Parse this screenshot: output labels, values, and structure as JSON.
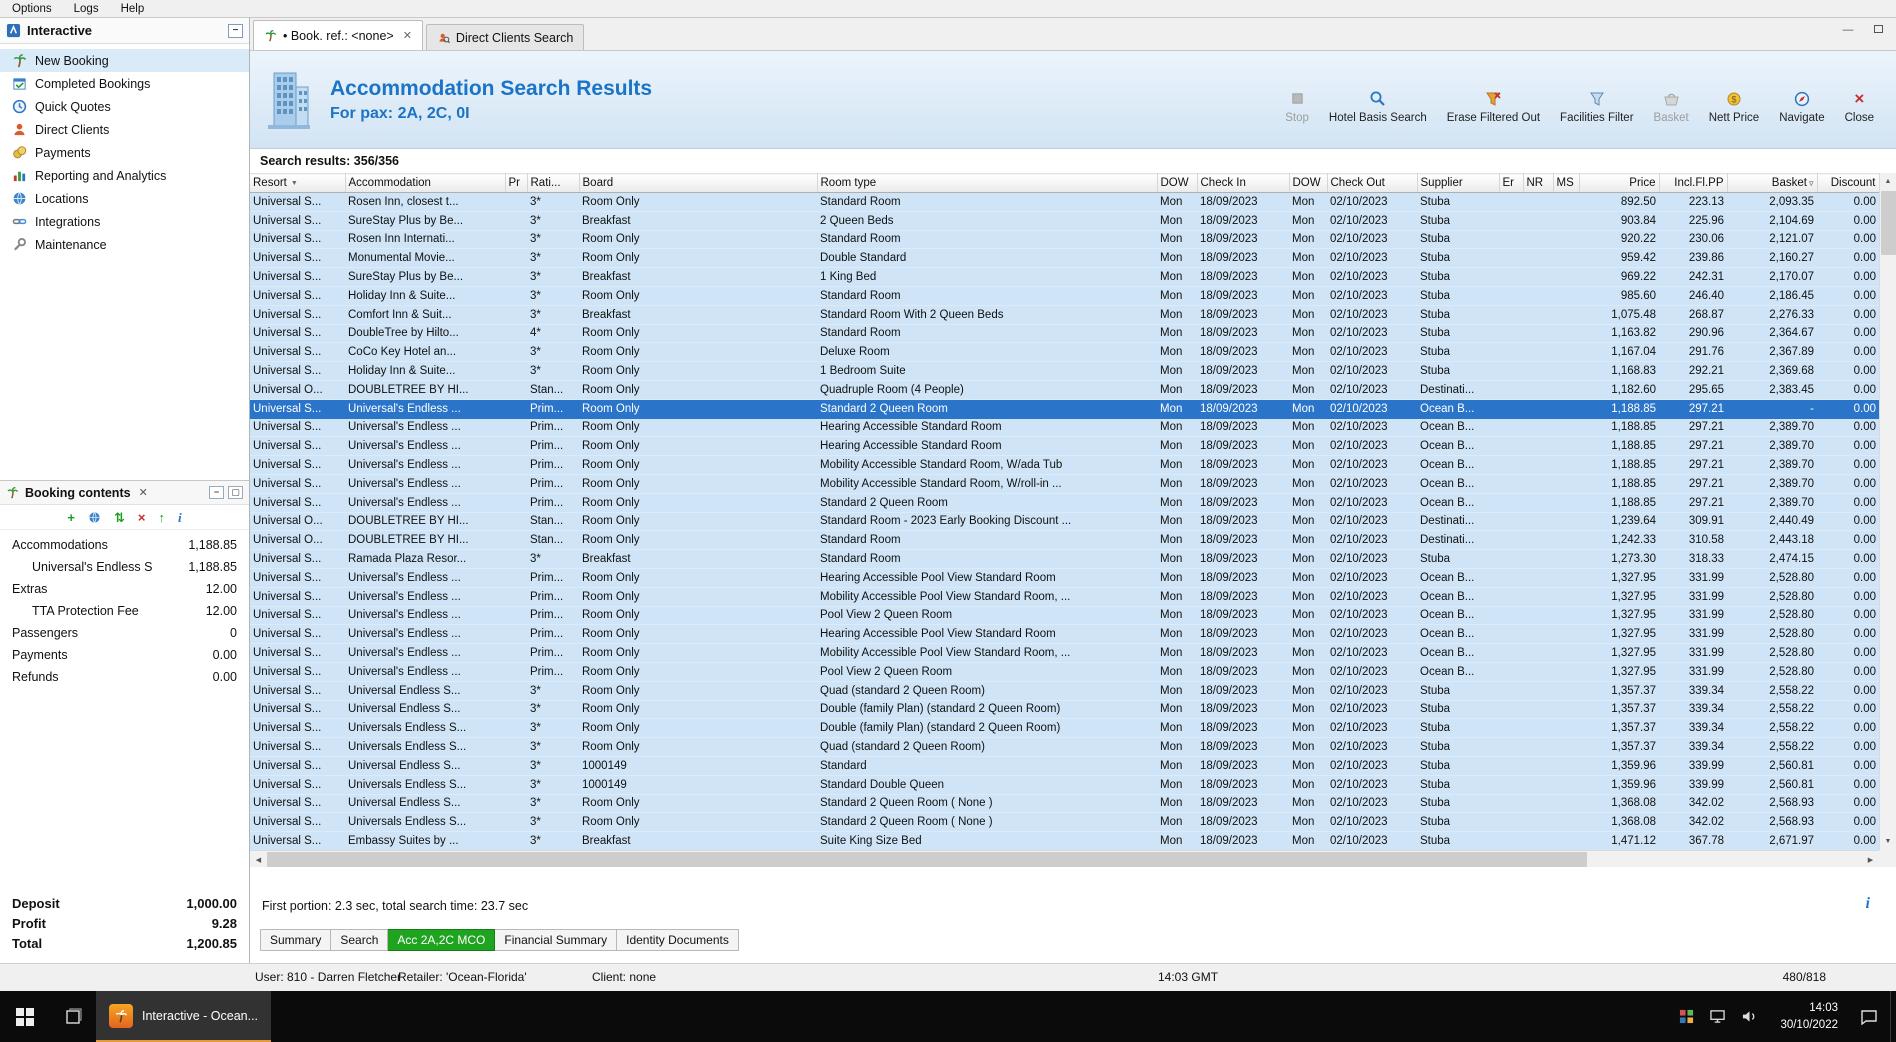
{
  "menu": {
    "items": [
      "Options",
      "Logs",
      "Help"
    ]
  },
  "sidebar": {
    "title": "Interactive",
    "items": [
      {
        "label": "New Booking"
      },
      {
        "label": "Completed Bookings"
      },
      {
        "label": "Quick Quotes"
      },
      {
        "label": "Direct Clients"
      },
      {
        "label": "Payments"
      },
      {
        "label": "Reporting and Analytics"
      },
      {
        "label": "Locations"
      },
      {
        "label": "Integrations"
      },
      {
        "label": "Maintenance"
      }
    ]
  },
  "booking_contents": {
    "title": "Booking contents",
    "tree": [
      {
        "label": "Accommodations",
        "value": "1,188.85",
        "indent": 0
      },
      {
        "label": "Universal's Endless S",
        "value": "1,188.85",
        "indent": 1
      },
      {
        "label": "Extras",
        "value": "12.00",
        "indent": 0
      },
      {
        "label": "TTA Protection Fee",
        "value": "12.00",
        "indent": 1
      },
      {
        "label": "Passengers",
        "value": "0",
        "indent": 0
      },
      {
        "label": "Payments",
        "value": "0.00",
        "indent": 0
      },
      {
        "label": "Refunds",
        "value": "0.00",
        "indent": 0
      }
    ],
    "totals": [
      {
        "label": "Deposit",
        "value": "1,000.00"
      },
      {
        "label": "Profit",
        "value": "9.28"
      },
      {
        "label": "Total",
        "value": "1,200.85"
      }
    ]
  },
  "tabs": [
    {
      "label": "• Book. ref.: <none>",
      "active": true
    },
    {
      "label": "Direct Clients Search",
      "active": false
    }
  ],
  "header": {
    "title": "Accommodation Search Results",
    "subtitle": "For pax: 2A, 2C, 0I",
    "toolbar": [
      {
        "label": "Stop",
        "disabled": true
      },
      {
        "label": "Hotel Basis Search",
        "disabled": false
      },
      {
        "label": "Erase Filtered Out",
        "disabled": false
      },
      {
        "label": "Facilities Filter",
        "disabled": false
      },
      {
        "label": "Basket",
        "disabled": true
      },
      {
        "label": "Nett Price",
        "disabled": false
      },
      {
        "label": "Navigate",
        "disabled": false
      },
      {
        "label": "Close",
        "disabled": false
      }
    ]
  },
  "results": {
    "label": "Search results: 356/356"
  },
  "table": {
    "columns": [
      "Resort",
      "Accommodation",
      "Pr",
      "Rati...",
      "Board",
      "Room type",
      "DOW",
      "Check In",
      "DOW",
      "Check Out",
      "Supplier",
      "Er",
      "NR",
      "MS",
      "Price",
      "Incl.Fl.PP",
      "Basket",
      "Discount"
    ],
    "selected_index": 11,
    "rows": [
      [
        "Universal S...",
        "Rosen Inn, closest t...",
        "",
        "3*",
        "Room Only",
        "Standard Room",
        "Mon",
        "18/09/2023",
        "Mon",
        "02/10/2023",
        "Stuba",
        "",
        "",
        "",
        "892.50",
        "223.13",
        "2,093.35",
        "0.00"
      ],
      [
        "Universal S...",
        "SureStay Plus by Be...",
        "",
        "3*",
        "Breakfast",
        "2 Queen Beds",
        "Mon",
        "18/09/2023",
        "Mon",
        "02/10/2023",
        "Stuba",
        "",
        "",
        "",
        "903.84",
        "225.96",
        "2,104.69",
        "0.00"
      ],
      [
        "Universal S...",
        "Rosen Inn Internati...",
        "",
        "3*",
        "Room Only",
        "Standard Room",
        "Mon",
        "18/09/2023",
        "Mon",
        "02/10/2023",
        "Stuba",
        "",
        "",
        "",
        "920.22",
        "230.06",
        "2,121.07",
        "0.00"
      ],
      [
        "Universal S...",
        "Monumental Movie...",
        "",
        "3*",
        "Room Only",
        "Double Standard",
        "Mon",
        "18/09/2023",
        "Mon",
        "02/10/2023",
        "Stuba",
        "",
        "",
        "",
        "959.42",
        "239.86",
        "2,160.27",
        "0.00"
      ],
      [
        "Universal S...",
        "SureStay Plus by Be...",
        "",
        "3*",
        "Breakfast",
        "1 King Bed",
        "Mon",
        "18/09/2023",
        "Mon",
        "02/10/2023",
        "Stuba",
        "",
        "",
        "",
        "969.22",
        "242.31",
        "2,170.07",
        "0.00"
      ],
      [
        "Universal S...",
        "Holiday Inn & Suite...",
        "",
        "3*",
        "Room Only",
        "Standard Room",
        "Mon",
        "18/09/2023",
        "Mon",
        "02/10/2023",
        "Stuba",
        "",
        "",
        "",
        "985.60",
        "246.40",
        "2,186.45",
        "0.00"
      ],
      [
        "Universal S...",
        "Comfort Inn & Suit...",
        "",
        "3*",
        "Breakfast",
        "Standard Room With 2 Queen Beds",
        "Mon",
        "18/09/2023",
        "Mon",
        "02/10/2023",
        "Stuba",
        "",
        "",
        "",
        "1,075.48",
        "268.87",
        "2,276.33",
        "0.00"
      ],
      [
        "Universal S...",
        "DoubleTree by Hilto...",
        "",
        "4*",
        "Room Only",
        "Standard Room",
        "Mon",
        "18/09/2023",
        "Mon",
        "02/10/2023",
        "Stuba",
        "",
        "",
        "",
        "1,163.82",
        "290.96",
        "2,364.67",
        "0.00"
      ],
      [
        "Universal S...",
        "CoCo Key Hotel an...",
        "",
        "3*",
        "Room Only",
        "Deluxe Room",
        "Mon",
        "18/09/2023",
        "Mon",
        "02/10/2023",
        "Stuba",
        "",
        "",
        "",
        "1,167.04",
        "291.76",
        "2,367.89",
        "0.00"
      ],
      [
        "Universal S...",
        "Holiday Inn & Suite...",
        "",
        "3*",
        "Room Only",
        "1 Bedroom Suite",
        "Mon",
        "18/09/2023",
        "Mon",
        "02/10/2023",
        "Stuba",
        "",
        "",
        "",
        "1,168.83",
        "292.21",
        "2,369.68",
        "0.00"
      ],
      [
        "Universal O...",
        "DOUBLETREE BY HI...",
        "",
        "Stan...",
        "Room Only",
        "Quadruple Room (4 People)",
        "Mon",
        "18/09/2023",
        "Mon",
        "02/10/2023",
        "Destinati...",
        "",
        "",
        "",
        "1,182.60",
        "295.65",
        "2,383.45",
        "0.00"
      ],
      [
        "Universal S...",
        "Universal's Endless ...",
        "",
        "Prim...",
        "Room Only",
        "Standard 2 Queen Room",
        "Mon",
        "18/09/2023",
        "Mon",
        "02/10/2023",
        "Ocean B...",
        "",
        "",
        "",
        "1,188.85",
        "297.21",
        "-",
        "0.00"
      ],
      [
        "Universal S...",
        "Universal's Endless ...",
        "",
        "Prim...",
        "Room Only",
        "Hearing Accessible Standard Room",
        "Mon",
        "18/09/2023",
        "Mon",
        "02/10/2023",
        "Ocean B...",
        "",
        "",
        "",
        "1,188.85",
        "297.21",
        "2,389.70",
        "0.00"
      ],
      [
        "Universal S...",
        "Universal's Endless ...",
        "",
        "Prim...",
        "Room Only",
        "Hearing Accessible Standard Room",
        "Mon",
        "18/09/2023",
        "Mon",
        "02/10/2023",
        "Ocean B...",
        "",
        "",
        "",
        "1,188.85",
        "297.21",
        "2,389.70",
        "0.00"
      ],
      [
        "Universal S...",
        "Universal's Endless ...",
        "",
        "Prim...",
        "Room Only",
        "Mobility Accessible Standard Room, W/ada Tub",
        "Mon",
        "18/09/2023",
        "Mon",
        "02/10/2023",
        "Ocean B...",
        "",
        "",
        "",
        "1,188.85",
        "297.21",
        "2,389.70",
        "0.00"
      ],
      [
        "Universal S...",
        "Universal's Endless ...",
        "",
        "Prim...",
        "Room Only",
        "Mobility Accessible Standard Room, W/roll-in ...",
        "Mon",
        "18/09/2023",
        "Mon",
        "02/10/2023",
        "Ocean B...",
        "",
        "",
        "",
        "1,188.85",
        "297.21",
        "2,389.70",
        "0.00"
      ],
      [
        "Universal S...",
        "Universal's Endless ...",
        "",
        "Prim...",
        "Room Only",
        "Standard 2 Queen Room",
        "Mon",
        "18/09/2023",
        "Mon",
        "02/10/2023",
        "Ocean B...",
        "",
        "",
        "",
        "1,188.85",
        "297.21",
        "2,389.70",
        "0.00"
      ],
      [
        "Universal O...",
        "DOUBLETREE BY HI...",
        "",
        "Stan...",
        "Room Only",
        "Standard Room - 2023 Early Booking Discount ...",
        "Mon",
        "18/09/2023",
        "Mon",
        "02/10/2023",
        "Destinati...",
        "",
        "",
        "",
        "1,239.64",
        "309.91",
        "2,440.49",
        "0.00"
      ],
      [
        "Universal O...",
        "DOUBLETREE BY HI...",
        "",
        "Stan...",
        "Room Only",
        "Standard Room",
        "Mon",
        "18/09/2023",
        "Mon",
        "02/10/2023",
        "Destinati...",
        "",
        "",
        "",
        "1,242.33",
        "310.58",
        "2,443.18",
        "0.00"
      ],
      [
        "Universal S...",
        "Ramada Plaza Resor...",
        "",
        "3*",
        "Breakfast",
        "Standard Room",
        "Mon",
        "18/09/2023",
        "Mon",
        "02/10/2023",
        "Stuba",
        "",
        "",
        "",
        "1,273.30",
        "318.33",
        "2,474.15",
        "0.00"
      ],
      [
        "Universal S...",
        "Universal's Endless ...",
        "",
        "Prim...",
        "Room Only",
        "Hearing Accessible Pool View Standard Room",
        "Mon",
        "18/09/2023",
        "Mon",
        "02/10/2023",
        "Ocean B...",
        "",
        "",
        "",
        "1,327.95",
        "331.99",
        "2,528.80",
        "0.00"
      ],
      [
        "Universal S...",
        "Universal's Endless ...",
        "",
        "Prim...",
        "Room Only",
        "Mobility Accessible Pool View Standard Room, ...",
        "Mon",
        "18/09/2023",
        "Mon",
        "02/10/2023",
        "Ocean B...",
        "",
        "",
        "",
        "1,327.95",
        "331.99",
        "2,528.80",
        "0.00"
      ],
      [
        "Universal S...",
        "Universal's Endless ...",
        "",
        "Prim...",
        "Room Only",
        "Pool View 2 Queen Room",
        "Mon",
        "18/09/2023",
        "Mon",
        "02/10/2023",
        "Ocean B...",
        "",
        "",
        "",
        "1,327.95",
        "331.99",
        "2,528.80",
        "0.00"
      ],
      [
        "Universal S...",
        "Universal's Endless ...",
        "",
        "Prim...",
        "Room Only",
        "Hearing Accessible Pool View Standard Room",
        "Mon",
        "18/09/2023",
        "Mon",
        "02/10/2023",
        "Ocean B...",
        "",
        "",
        "",
        "1,327.95",
        "331.99",
        "2,528.80",
        "0.00"
      ],
      [
        "Universal S...",
        "Universal's Endless ...",
        "",
        "Prim...",
        "Room Only",
        "Mobility Accessible Pool View Standard Room, ...",
        "Mon",
        "18/09/2023",
        "Mon",
        "02/10/2023",
        "Ocean B...",
        "",
        "",
        "",
        "1,327.95",
        "331.99",
        "2,528.80",
        "0.00"
      ],
      [
        "Universal S...",
        "Universal's Endless ...",
        "",
        "Prim...",
        "Room Only",
        "Pool View 2 Queen Room",
        "Mon",
        "18/09/2023",
        "Mon",
        "02/10/2023",
        "Ocean B...",
        "",
        "",
        "",
        "1,327.95",
        "331.99",
        "2,528.80",
        "0.00"
      ],
      [
        "Universal S...",
        "Universal Endless S...",
        "",
        "3*",
        "Room Only",
        "Quad (standard 2 Queen Room)",
        "Mon",
        "18/09/2023",
        "Mon",
        "02/10/2023",
        "Stuba",
        "",
        "",
        "",
        "1,357.37",
        "339.34",
        "2,558.22",
        "0.00"
      ],
      [
        "Universal S...",
        "Universal Endless S...",
        "",
        "3*",
        "Room Only",
        "Double (family Plan) (standard 2 Queen Room)",
        "Mon",
        "18/09/2023",
        "Mon",
        "02/10/2023",
        "Stuba",
        "",
        "",
        "",
        "1,357.37",
        "339.34",
        "2,558.22",
        "0.00"
      ],
      [
        "Universal S...",
        "Universals Endless S...",
        "",
        "3*",
        "Room Only",
        "Double (family Plan) (standard 2 Queen Room)",
        "Mon",
        "18/09/2023",
        "Mon",
        "02/10/2023",
        "Stuba",
        "",
        "",
        "",
        "1,357.37",
        "339.34",
        "2,558.22",
        "0.00"
      ],
      [
        "Universal S...",
        "Universals Endless S...",
        "",
        "3*",
        "Room Only",
        "Quad (standard 2 Queen Room)",
        "Mon",
        "18/09/2023",
        "Mon",
        "02/10/2023",
        "Stuba",
        "",
        "",
        "",
        "1,357.37",
        "339.34",
        "2,558.22",
        "0.00"
      ],
      [
        "Universal S...",
        "Universal Endless S...",
        "",
        "3*",
        "1000149",
        "Standard",
        "Mon",
        "18/09/2023",
        "Mon",
        "02/10/2023",
        "Stuba",
        "",
        "",
        "",
        "1,359.96",
        "339.99",
        "2,560.81",
        "0.00"
      ],
      [
        "Universal S...",
        "Universals Endless S...",
        "",
        "3*",
        "1000149",
        "Standard Double Queen",
        "Mon",
        "18/09/2023",
        "Mon",
        "02/10/2023",
        "Stuba",
        "",
        "",
        "",
        "1,359.96",
        "339.99",
        "2,560.81",
        "0.00"
      ],
      [
        "Universal S...",
        "Universal Endless S...",
        "",
        "3*",
        "Room Only",
        "Standard 2 Queen Room ( None )",
        "Mon",
        "18/09/2023",
        "Mon",
        "02/10/2023",
        "Stuba",
        "",
        "",
        "",
        "1,368.08",
        "342.02",
        "2,568.93",
        "0.00"
      ],
      [
        "Universal S...",
        "Universals Endless S...",
        "",
        "3*",
        "Room Only",
        "Standard 2 Queen Room ( None )",
        "Mon",
        "18/09/2023",
        "Mon",
        "02/10/2023",
        "Stuba",
        "",
        "",
        "",
        "1,368.08",
        "342.02",
        "2,568.93",
        "0.00"
      ],
      [
        "Universal S...",
        "Embassy Suites by ...",
        "",
        "3*",
        "Breakfast",
        "Suite King Size Bed",
        "Mon",
        "18/09/2023",
        "Mon",
        "02/10/2023",
        "Stuba",
        "",
        "",
        "",
        "1,471.12",
        "367.78",
        "2,671.97",
        "0.00"
      ]
    ]
  },
  "status_line": {
    "text": "First portion: 2.3 sec, total search time: 23.7 sec"
  },
  "bottom_tabs": {
    "items": [
      "Summary",
      "Search",
      "Acc 2A,2C MCO",
      "Financial Summary",
      "Identity Documents"
    ],
    "active_index": 2,
    "active_color": "#1fa41f"
  },
  "status_bar": {
    "user": "User: 810 - Darren Fletcher",
    "retailer": "Retailer: 'Ocean-Florida'",
    "client": "Client: none",
    "time": "14:03 GMT",
    "counter": "480/818"
  },
  "taskbar": {
    "app_label": "Interactive - Ocean...",
    "time": "14:03",
    "date": "30/10/2022"
  }
}
